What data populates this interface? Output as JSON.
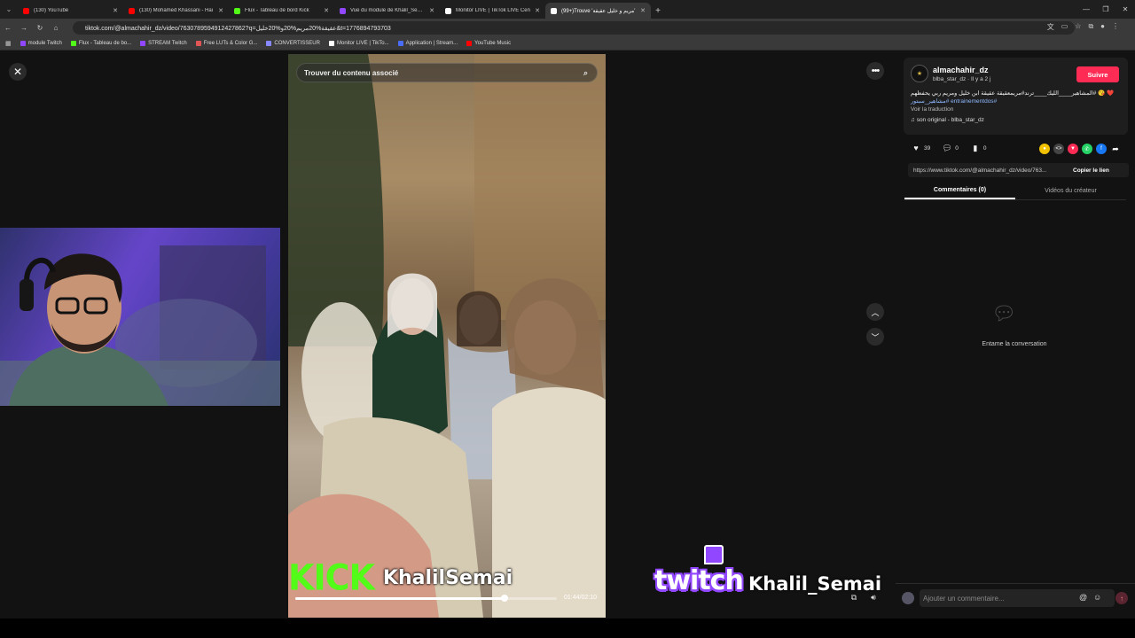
{
  "browser": {
    "tabs": [
      {
        "title": "(130) YouTube",
        "color": "#ff0000"
      },
      {
        "title": "(130) Mohamed Khassani - Hai",
        "color": "#ff0000"
      },
      {
        "title": "Flux - Tableau de bord Kick",
        "color": "#53fc18"
      },
      {
        "title": "Vue du module de Khalil_Semai",
        "color": "#9146ff"
      },
      {
        "title": "Monitor LIVE | TikTok LIVE Cen",
        "color": "#ffffff"
      },
      {
        "title": "(99+)Trouve 'مريم و خليل عقيقة'",
        "color": "#ffffff",
        "active": true
      }
    ],
    "new_tab": "+",
    "url": "tiktok.com/@almachahir_dz/video/7630789594912427862?q=عقيقة%20مريم%20و%20خليل&t=1776894793703",
    "bookmarks": [
      {
        "label": "module Twitch",
        "color": "#9146ff"
      },
      {
        "label": "Flux - Tableau de bo...",
        "color": "#53fc18"
      },
      {
        "label": "STREAM Twitch",
        "color": "#9146ff"
      },
      {
        "label": "Free LUTs & Color G...",
        "color": "#e05555"
      },
      {
        "label": "CONVERTISSEUR",
        "color": "#8888ff"
      },
      {
        "label": "Monitor LIVE | TikTo...",
        "color": "#ffffff"
      },
      {
        "label": "Application | Stream...",
        "color": "#4a6cf7"
      },
      {
        "label": "YouTube Music",
        "color": "#ff0000"
      }
    ]
  },
  "video": {
    "search_placeholder": "Trouver du contenu associé",
    "progress": 0.8,
    "timecode": "01:44/02:10"
  },
  "overlays": {
    "kick_word": "KICK",
    "kick_user": "KhalilSemai",
    "twitch_word": "twitch",
    "twitch_user": "Khalil_Semai"
  },
  "author": {
    "name": "almachahir_dz",
    "sub": "blba_star_dz · Il y a 2 j",
    "follow_label": "Suivre",
    "description_text": "❤️ 😘 #المشاهير____الليك____ترند#مريمعقيقة عقيقة ابن خليل ومريم ربي يحفظهم",
    "description_tags": "#entrainementdos #مشاهير_سبتور",
    "translate_label": "Voir la traduction",
    "sound_label": "son original - blba_star_dz"
  },
  "stats": {
    "likes": "39",
    "comments": "0",
    "saves": "0"
  },
  "link": {
    "url": "https://www.tiktok.com/@almachahir_dz/video/763...",
    "copy_label": "Copier le lien"
  },
  "side_tabs": {
    "comments": "Commentaires (0)",
    "creator_videos": "Vidéos du créateur"
  },
  "empty": {
    "text": "Entame la conversation"
  },
  "comment_box": {
    "placeholder": "Ajouter un commentaire..."
  }
}
